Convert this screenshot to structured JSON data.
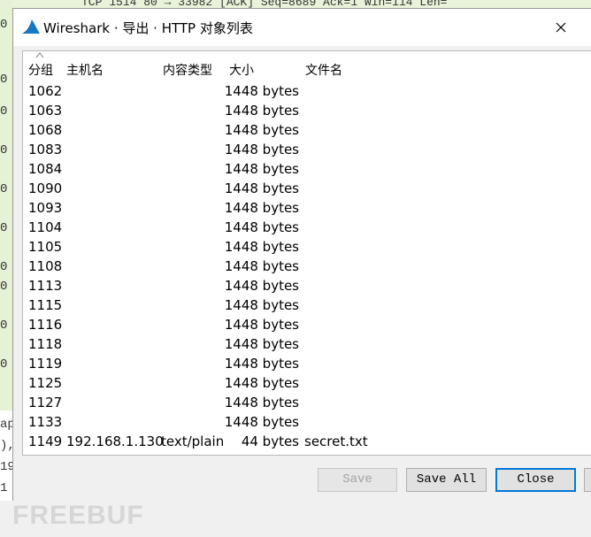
{
  "background_packet_line": "TCP      1514 80 → 33982 [ACK] Seq=8689 Ack=1 Win=114 Len=",
  "background_left_digits": [
    "0",
    "0",
    "0",
    "0",
    "0",
    "0",
    "0",
    "0",
    "0",
    "0"
  ],
  "background_left_fragments": [
    "ap",
    "),",
    "19",
    "1"
  ],
  "watermark_text": "FREEBUF",
  "window": {
    "title": "Wireshark · 导出 · HTTP 对象列表",
    "accent_color": "#0078d7"
  },
  "table": {
    "headers": {
      "packet": "分组",
      "hostname": "主机名",
      "content_type": "内容类型",
      "size": "大小",
      "filename": "文件名"
    },
    "rows": [
      {
        "packet": "1062",
        "hostname": "",
        "content_type": "",
        "size": "1448 bytes",
        "filename": ""
      },
      {
        "packet": "1063",
        "hostname": "",
        "content_type": "",
        "size": "1448 bytes",
        "filename": ""
      },
      {
        "packet": "1068",
        "hostname": "",
        "content_type": "",
        "size": "1448 bytes",
        "filename": ""
      },
      {
        "packet": "1083",
        "hostname": "",
        "content_type": "",
        "size": "1448 bytes",
        "filename": ""
      },
      {
        "packet": "1084",
        "hostname": "",
        "content_type": "",
        "size": "1448 bytes",
        "filename": ""
      },
      {
        "packet": "1090",
        "hostname": "",
        "content_type": "",
        "size": "1448 bytes",
        "filename": ""
      },
      {
        "packet": "1093",
        "hostname": "",
        "content_type": "",
        "size": "1448 bytes",
        "filename": ""
      },
      {
        "packet": "1104",
        "hostname": "",
        "content_type": "",
        "size": "1448 bytes",
        "filename": ""
      },
      {
        "packet": "1105",
        "hostname": "",
        "content_type": "",
        "size": "1448 bytes",
        "filename": ""
      },
      {
        "packet": "1108",
        "hostname": "",
        "content_type": "",
        "size": "1448 bytes",
        "filename": ""
      },
      {
        "packet": "1113",
        "hostname": "",
        "content_type": "",
        "size": "1448 bytes",
        "filename": ""
      },
      {
        "packet": "1115",
        "hostname": "",
        "content_type": "",
        "size": "1448 bytes",
        "filename": ""
      },
      {
        "packet": "1116",
        "hostname": "",
        "content_type": "",
        "size": "1448 bytes",
        "filename": ""
      },
      {
        "packet": "1118",
        "hostname": "",
        "content_type": "",
        "size": "1448 bytes",
        "filename": ""
      },
      {
        "packet": "1119",
        "hostname": "",
        "content_type": "",
        "size": "1448 bytes",
        "filename": ""
      },
      {
        "packet": "1125",
        "hostname": "",
        "content_type": "",
        "size": "1448 bytes",
        "filename": ""
      },
      {
        "packet": "1127",
        "hostname": "",
        "content_type": "",
        "size": "1448 bytes",
        "filename": ""
      },
      {
        "packet": "1133",
        "hostname": "",
        "content_type": "",
        "size": "1448 bytes",
        "filename": ""
      },
      {
        "packet": "1149",
        "hostname": "192.168.1.130",
        "content_type": "text/plain",
        "size": "44 bytes",
        "filename": "secret.txt"
      }
    ]
  },
  "buttons": {
    "save": "Save",
    "save_all": "Save All",
    "close": "Close"
  }
}
